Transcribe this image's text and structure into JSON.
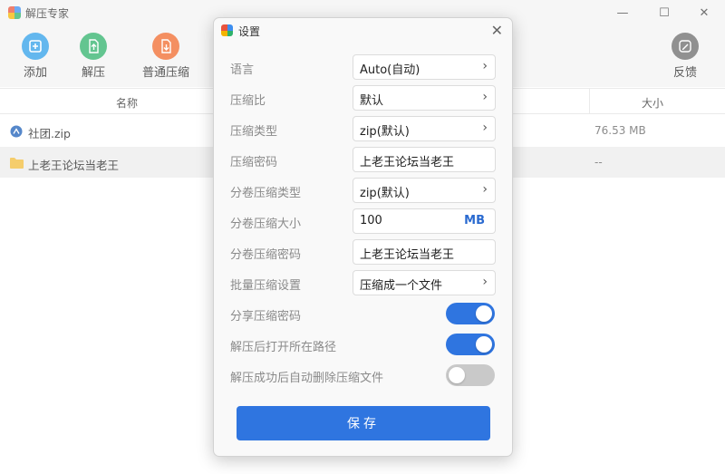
{
  "window": {
    "title": "解压专家",
    "minimize_glyph": "—",
    "maximize_glyph": "☐",
    "close_glyph": "✕"
  },
  "toolbar": {
    "add": {
      "label": "添加",
      "icon": "plus-icon",
      "color": "#2f9fe8"
    },
    "extract": {
      "label": "解压",
      "icon": "upload-doc-icon",
      "color": "#2fb26b"
    },
    "compress": {
      "label": "普通压缩",
      "icon": "archive-doc-icon",
      "color": "#f06a2d"
    },
    "feedback": {
      "label": "反馈",
      "icon": "pencil-comment-icon",
      "color": "#6b6b6b"
    }
  },
  "table": {
    "columns": {
      "name": "名称",
      "size": "大小"
    },
    "rows": [
      {
        "name": "社团.zip",
        "size": "76.53 MB",
        "icon": "zip-archive-icon"
      },
      {
        "name": "上老王论坛当老王",
        "size": "--",
        "icon": "folder-icon"
      }
    ]
  },
  "dialog": {
    "title": "设置",
    "close_glyph": "✕",
    "settings": [
      {
        "label": "语言",
        "value": "Auto(自动)"
      },
      {
        "label": "压缩比",
        "value": "默认"
      },
      {
        "label": "压缩类型",
        "value": "zip(默认)"
      },
      {
        "label": "压缩密码",
        "value": "上老王论坛当老王"
      },
      {
        "label": "分卷压缩类型",
        "value": "zip(默认)"
      },
      {
        "label": "分卷压缩大小",
        "value": "100",
        "unit": "MB"
      },
      {
        "label": "分卷压缩密码",
        "value": "上老王论坛当老王"
      },
      {
        "label": "批量压缩设置",
        "value": "压缩成一个文件"
      }
    ],
    "toggles": [
      {
        "label": "分享压缩密码",
        "on": true
      },
      {
        "label": "解压后打开所在路径",
        "on": true
      },
      {
        "label": "解压成功后自动删除压缩文件",
        "on": false
      }
    ],
    "save_label": "保存",
    "accent_color": "#2f75e0"
  }
}
